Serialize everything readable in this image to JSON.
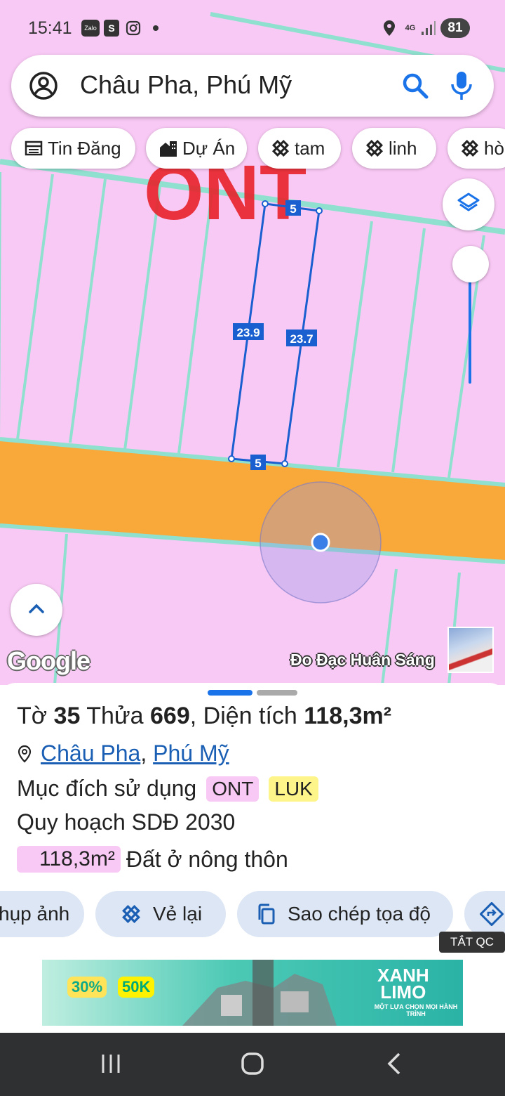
{
  "status_bar": {
    "time": "15:41",
    "zalo_label": "Zalo",
    "shop_label": "S",
    "network": "4G",
    "battery": "81"
  },
  "search": {
    "query": "Châu Pha, Phú Mỹ"
  },
  "chips": [
    {
      "icon": "newspaper-icon",
      "label": "Tin Đăng"
    },
    {
      "icon": "building-icon",
      "label": "Dự Án"
    },
    {
      "icon": "ruler-icon",
      "label": "tam"
    },
    {
      "icon": "ruler-icon",
      "label": "linh"
    },
    {
      "icon": "ruler-icon",
      "label": "hò"
    }
  ],
  "map": {
    "zone_label": "ONT",
    "edge_top": "5",
    "edge_bottom": "5",
    "edge_left": "23.9",
    "edge_right": "23.7",
    "google": "Google",
    "watermark": "Đo Đạc Huân Sáng",
    "colors": {
      "land_ont": "#f9c9f5",
      "road": "#f9a93a",
      "parcel_line": "#8fe0cf",
      "selection": "#1a5fd0"
    }
  },
  "parcel": {
    "sheet_label": "Tờ",
    "sheet_no": "35",
    "plot_label": "Thửa",
    "plot_no": "669",
    "area_label": "Diện tích",
    "area": "118,3m²",
    "commune": "Châu Pha",
    "town": "Phú Mỹ",
    "addr_sep": ",",
    "usage_label": "Mục đích sử dụng",
    "usage_tags": [
      "ONT",
      "LUK"
    ],
    "plan_label": "Quy hoạch SDĐ 2030",
    "plan_area": "118,3m²",
    "plan_desc": "Đất ở nông thôn"
  },
  "actions": [
    {
      "icon": "camera-icon",
      "label": "hụp ảnh"
    },
    {
      "icon": "ruler-icon",
      "label": "Vẻ lại"
    },
    {
      "icon": "copy-icon",
      "label": "Sao chép tọa độ"
    },
    {
      "icon": "directions-icon",
      "label": ""
    }
  ],
  "ad": {
    "close_label": "TẮT QC",
    "badge1": "30%",
    "badge2": "50K",
    "title_line1": "XANH",
    "title_line2": "LIMO",
    "subtitle": "MỘT LỰA CHỌN MỌI HÀNH TRÌNH"
  }
}
